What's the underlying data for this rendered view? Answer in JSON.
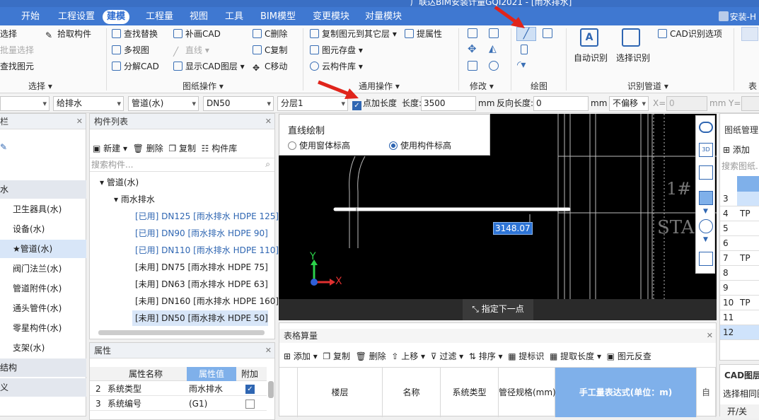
{
  "title": "广联达BIM安装计量GQI2021 - [雨水排水]",
  "menu": [
    "开始",
    "工程设置",
    "建模",
    "工程量",
    "视图",
    "工具",
    "BIM模型",
    "变更模块",
    "对量模块"
  ],
  "menu_active": "建模",
  "user": "安装-H",
  "ribbon": {
    "select_group": {
      "items": [
        "选择",
        "拾取构件",
        "批量选择",
        "查找图元"
      ],
      "label": "选择"
    },
    "cad_group": {
      "items": [
        "查找替换",
        "补画CAD",
        "C删除",
        "多视图",
        "直线",
        "C复制",
        "分解CAD",
        "显示CAD图层",
        "C移动"
      ],
      "label": "图纸操作"
    },
    "common_group": {
      "items": [
        "复制图元到其它层",
        "提属性",
        "图元存盘",
        "云构件库"
      ],
      "label": "通用操作"
    },
    "modify_label": "修改",
    "draw_label": "绘图",
    "identify_group": {
      "items": [
        "自动识别",
        "选择识别",
        "CAD识别选项"
      ],
      "label": "识别管道"
    },
    "table_label": "表"
  },
  "props": {
    "dd1": "",
    "dd2": "给排水",
    "dd3": "管道(水)",
    "dd4": "DN50",
    "dd5": "分层1",
    "add_len_label": "点加长度",
    "len_label": "长度:",
    "len_value": "3500",
    "len_unit": "mm",
    "rev_label": "反向长度:",
    "rev_value": "0",
    "rev_unit": "mm",
    "offset": "不偏移",
    "x_label": "X=",
    "x_value": "0",
    "x_unit": "mm",
    "y_label": "Y="
  },
  "left_nav": {
    "title": "栏",
    "items": [
      "水",
      "卫生器具(水)",
      "设备(水)",
      "★管道(水)",
      "阀门法兰(水)",
      "管道附件(水)",
      "通头管件(水)",
      "零星构件(水)",
      "支架(水)",
      "结构",
      "义"
    ]
  },
  "component_list": {
    "title": "构件列表",
    "toolbar": [
      "新建",
      "删除",
      "复制",
      "构件库"
    ],
    "search_placeholder": "搜索构件...",
    "tree": [
      "管道(水)",
      "雨水排水"
    ],
    "items": [
      "[已用] DN125 [雨水排水 HDPE 125]",
      "[已用] DN90 [雨水排水 HDPE 90]",
      "[已用] DN110 [雨水排水 HDPE 110]",
      "[未用] DN75 [雨水排水 HDPE 75]",
      "[未用] DN63 [雨水排水 HDPE 63]",
      "[未用] DN160 [雨水排水 HDPE 160]",
      "[未用] DN50 [雨水排水 HDPE 50]"
    ]
  },
  "properties": {
    "title": "属性",
    "headers": [
      "属性名称",
      "属性值",
      "附加"
    ],
    "rows": [
      {
        "n": "2",
        "name": "系统类型",
        "value": "雨水排水",
        "checked": true
      },
      {
        "n": "3",
        "name": "系统编号",
        "value": "(G1)",
        "checked": false
      }
    ]
  },
  "draw_popup": {
    "title": "直线绘制",
    "opt1": "使用窗体标高",
    "opt2": "使用构件标高"
  },
  "canvas": {
    "measure": "3148.07",
    "text1": "1#",
    "text2": "STAI",
    "axis_x": "X",
    "axis_y": "Y",
    "status": "指定下一点"
  },
  "table_calc": {
    "title": "表格算量",
    "toolbar": [
      "添加",
      "复制",
      "删除",
      "上移",
      "过滤",
      "排序",
      "提标识",
      "提取长度",
      "图元反查"
    ],
    "headers": [
      "楼层",
      "名称",
      "系统类型",
      "管径规格(mm)",
      "手工量表达式(单位：m)"
    ]
  },
  "drawing_mgmt": {
    "title": "图纸管理",
    "add": "添加",
    "search_placeholder": "搜索图纸...",
    "rows": [
      "3",
      "4",
      "5",
      "6",
      "7",
      "8",
      "9",
      "10",
      "11",
      "12"
    ],
    "row_labels": [
      "",
      "TP",
      "",
      "",
      "TP",
      "",
      "",
      "TP",
      "",
      ""
    ]
  },
  "cad_layer": {
    "title": "CAD图层",
    "text": "选择相同图",
    "col": "开/关"
  }
}
